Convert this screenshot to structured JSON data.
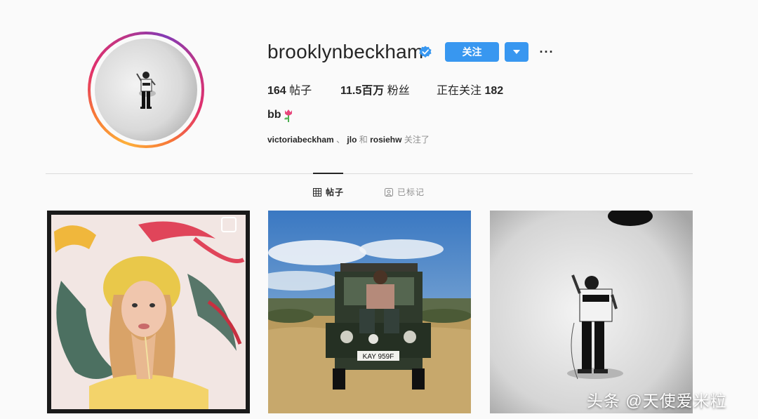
{
  "profile": {
    "username": "brooklynbeckham",
    "follow_label": "关注",
    "more_label": "···",
    "stats": {
      "posts_count": "164",
      "posts_label": "帖子",
      "followers_count": "11.5百万",
      "followers_label": "粉丝",
      "following_label": "正在关注",
      "following_count": "182"
    },
    "bio_name": "bb",
    "followed_by": {
      "account1": "victoriabeckham",
      "sep1": "、",
      "account2": "jlo",
      "and_text": "和",
      "account3": "rosiehw",
      "suffix": "关注了"
    }
  },
  "tabs": {
    "posts_label": "帖子",
    "tagged_label": "已标记"
  },
  "posts": {
    "post2_plate": "KAY 959F"
  },
  "watermark": "头条 @天使爱米粒",
  "colors": {
    "accent": "#3897f0",
    "verified": "#3897f0",
    "text": "#262626",
    "secondary_text": "#8e8e8e"
  },
  "icons": [
    "verified-badge-icon",
    "chevron-down-icon",
    "more-options-icon",
    "grid-icon",
    "tagged-icon",
    "multi-photo-icon",
    "tulip-emoji-icon"
  ]
}
